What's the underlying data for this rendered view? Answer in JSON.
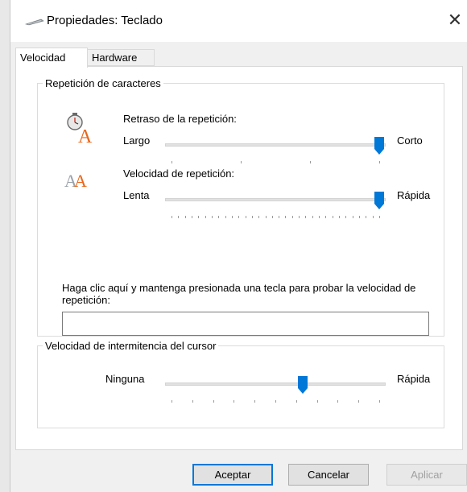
{
  "window": {
    "title": "Propiedades: Teclado",
    "close_symbol": "✕"
  },
  "tabs": [
    {
      "label": "Velocidad",
      "active": true
    },
    {
      "label": "Hardware",
      "active": false
    }
  ],
  "char_repeat": {
    "group_title": "Repetición de caracteres",
    "delay": {
      "label": "Retraso de la repetición:",
      "min_label": "Largo",
      "max_label": "Corto",
      "value": 1.0,
      "tick_count": 4,
      "icon": "clock-letter-a-icon"
    },
    "rate": {
      "label": "Velocidad de repetición:",
      "min_label": "Lenta",
      "max_label": "Rápida",
      "value": 1.0,
      "tick_count": 32,
      "icon": "double-letter-a-icon"
    },
    "test_prompt": "Haga clic aquí y mantenga presionada una tecla para probar la velocidad de repetición:",
    "test_value": ""
  },
  "cursor_blink": {
    "group_title": "Velocidad de intermitencia del cursor",
    "min_label": "Ninguna",
    "max_label": "Rápida",
    "value": 0.63,
    "tick_count": 11
  },
  "buttons": {
    "ok": "Aceptar",
    "cancel": "Cancelar",
    "apply": "Aplicar"
  },
  "colors": {
    "accent": "#0078d7",
    "disabled_text": "#a0a0a0"
  }
}
